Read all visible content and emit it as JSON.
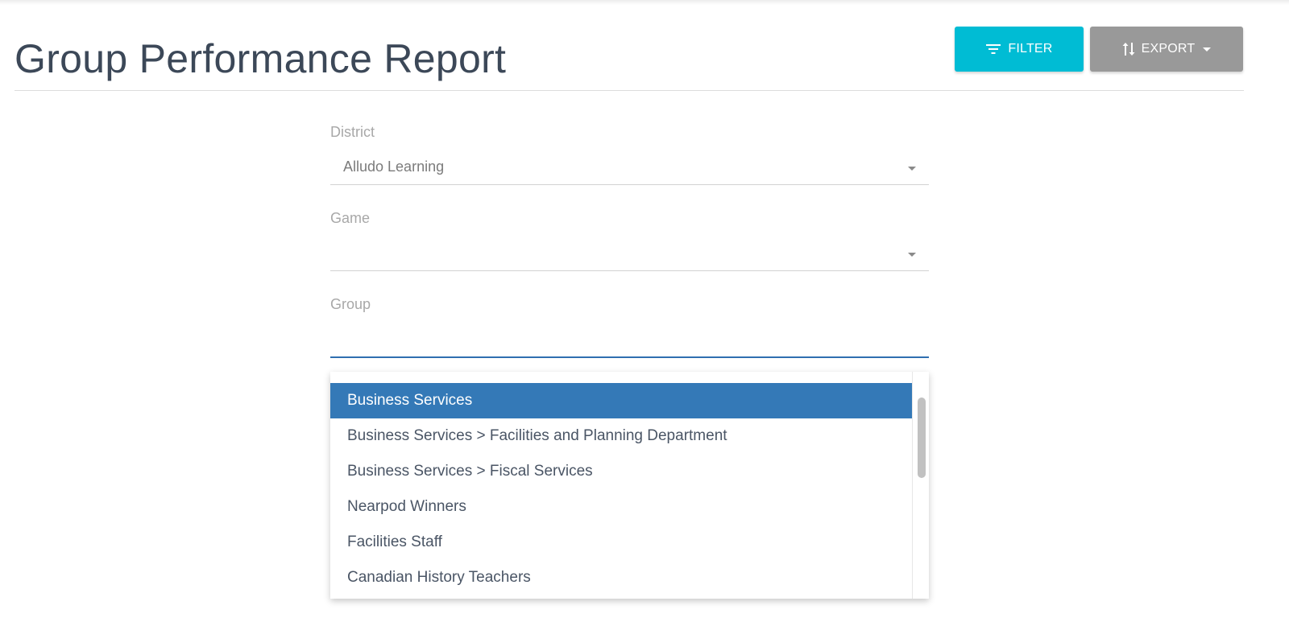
{
  "header": {
    "title": "Group Performance Report",
    "filter_label": "FILTER",
    "export_label": "EXPORT"
  },
  "form": {
    "district": {
      "label": "District",
      "value": "Alludo Learning"
    },
    "game": {
      "label": "Game",
      "value": ""
    },
    "group": {
      "label": "Group",
      "value": ""
    }
  },
  "dropdown": {
    "options": [
      "Business Services",
      "Business Services > Facilities and Planning Department",
      "Business Services > Fiscal Services",
      "Nearpod Winners",
      "Facilities Staff",
      "Canadian History Teachers"
    ],
    "highlighted_index": 0
  },
  "colors": {
    "filter_button": "#00bcd4",
    "export_button": "#999999",
    "highlight": "#3479b7",
    "active_underline": "#2f6fb0"
  },
  "icons": {
    "filter": "filter-lines-icon",
    "export": "sort-arrows-icon",
    "dropdown": "caret-down-icon"
  }
}
